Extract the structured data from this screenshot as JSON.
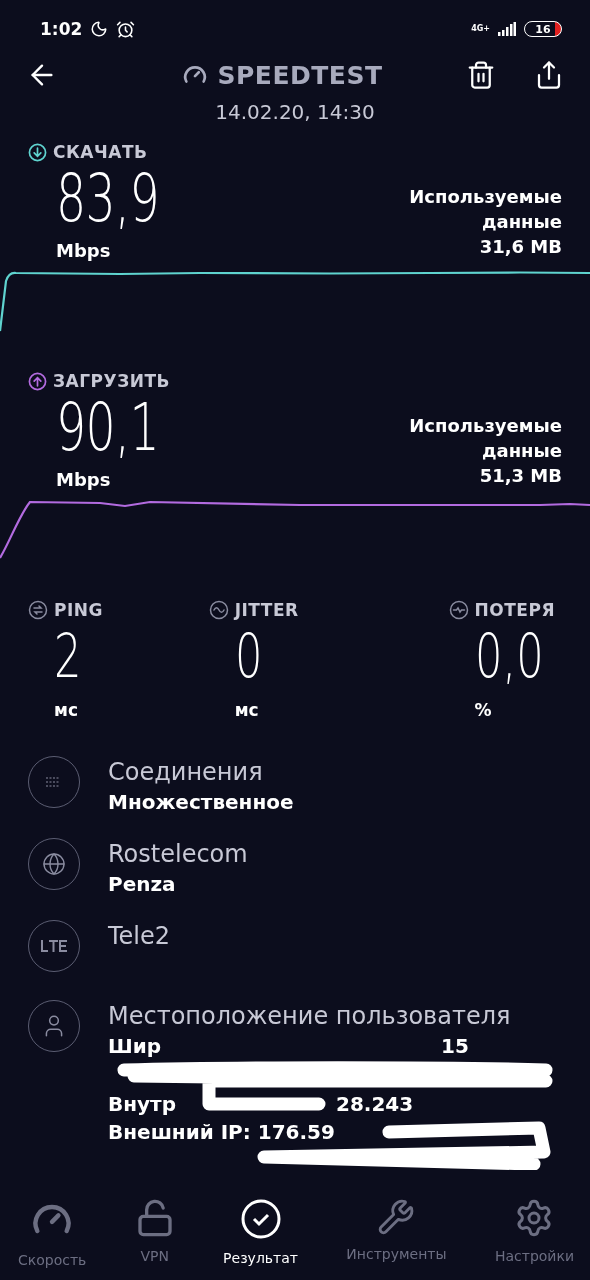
{
  "status_bar": {
    "time": "1:02",
    "network": "4G+",
    "battery": "16"
  },
  "header": {
    "title": "SPEEDTEST",
    "date": "14.02.20, 14:30"
  },
  "results": [
    {
      "kind": "download",
      "label": "СКАЧАТЬ",
      "value": "83,9",
      "unit": "Mbps",
      "data_label": "Используемые данные",
      "data_value": "31,6 MB",
      "color": "#5fd3cf"
    },
    {
      "kind": "upload",
      "label": "ЗАГРУЗИТЬ",
      "value": "90,1",
      "unit": "Mbps",
      "data_label": "Используемые данные",
      "data_value": "51,3 MB",
      "color": "#b36be0"
    }
  ],
  "stats": [
    {
      "kind": "ping",
      "label": "PING",
      "value": "2",
      "unit": "мс"
    },
    {
      "kind": "jitter",
      "label": "JITTER",
      "value": "0",
      "unit": "мс"
    },
    {
      "kind": "loss",
      "label": "ПОТЕРЯ",
      "value": "0,0",
      "unit": "%"
    }
  ],
  "details": [
    {
      "kind": "connections",
      "title": "Соединения",
      "subtitle": "Множественное"
    },
    {
      "kind": "server",
      "title": "Rostelecom",
      "subtitle": "Penza"
    },
    {
      "kind": "carrier",
      "title": "Tele2"
    },
    {
      "kind": "location",
      "title": "Местоположение пользователя",
      "lines": [
        [
          "Шир",
          "15"
        ],
        [
          "Внутр",
          "28.243"
        ],
        [
          "Внешний IP: 176.59"
        ]
      ]
    }
  ],
  "nav": [
    {
      "kind": "speed",
      "label": "Скорость",
      "selected": false
    },
    {
      "kind": "vpn",
      "label": "VPN",
      "selected": false
    },
    {
      "kind": "result",
      "label": "Результат",
      "selected": true
    },
    {
      "kind": "tools",
      "label": "Инструменты",
      "selected": false
    },
    {
      "kind": "settings",
      "label": "Настройки",
      "selected": false
    }
  ]
}
